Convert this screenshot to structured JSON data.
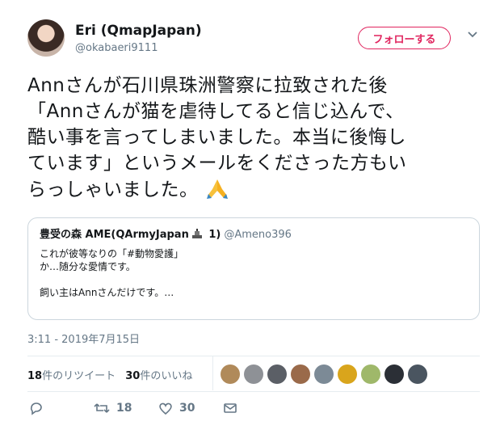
{
  "author": {
    "name": "Eri (QmapJapan)",
    "handle": "@okabaeri9111"
  },
  "follow_button": {
    "label": "フォローする"
  },
  "tweet": {
    "text": "Annさんが石川県珠洲警察に拉致された後\n「Annさんが猫を虐待してると信じ込んで、\n酷い事を言ってしまいました。本当に後悔し\nています」というメールをくださった方もい\nらっしゃいました。",
    "timestamp": "3:11 - 2019年7月15日"
  },
  "quoted_tweet": {
    "name_prefix": "豊受の森 AME(QArmyJapan",
    "name_suffix": " 1)",
    "handle": "@Ameno396",
    "body": "これが彼等なりの「#動物愛護」\nか…随分な愛情です。\n\n飼い主はAnnさんだけです。…"
  },
  "stats": {
    "retweets_count": "18",
    "retweets_label": "件のリツイート",
    "likes_count": "30",
    "likes_label": "件のいいね"
  },
  "liker_avatars": [
    {
      "color": "#b08a5a"
    },
    {
      "color": "#8e9196"
    },
    {
      "color": "#5b5f66"
    },
    {
      "color": "#9a6a4a"
    },
    {
      "color": "#7c8a96"
    },
    {
      "color": "#d9a51c"
    },
    {
      "color": "#9fb86a"
    },
    {
      "color": "#2b2f36"
    },
    {
      "color": "#4a5560"
    }
  ],
  "actions": {
    "reply_count": "",
    "retweet_count": "18",
    "like_count": "30"
  }
}
